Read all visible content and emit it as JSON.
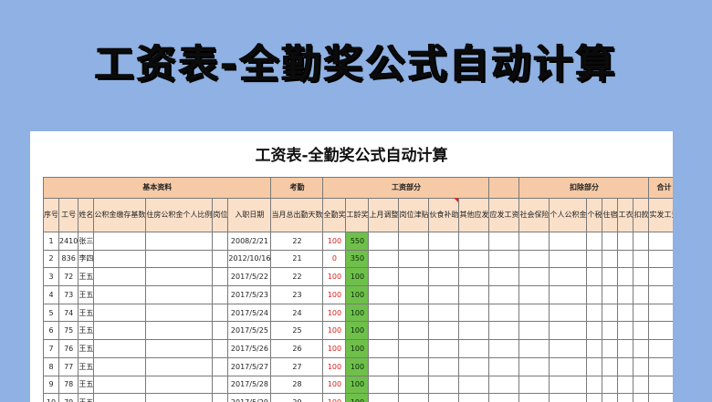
{
  "banner": {
    "title": "工资表-全勤奖公式自动计算"
  },
  "sheet": {
    "title": "工资表-全勤奖公式自动计算",
    "groups": {
      "basic": "基本资料",
      "attendance": "考勤",
      "salary": "工资部分",
      "deduction": "扣除部分",
      "total": "合计"
    },
    "columns": {
      "seq": "序号",
      "emp_no": "工号",
      "name": "姓名",
      "fund_base": "公积金缴存基数",
      "fund_ratio": "住房公积金个人比例",
      "position": "岗位",
      "hire_date": "入职日期",
      "days": "当月总出勤天数",
      "full_bonus": "全勤奖",
      "seniority": "工龄奖",
      "last_adjust": "上月调整",
      "post_allow": "岗位津贴",
      "meal_allow": "伙食补助",
      "other_pay": "其他应发",
      "gross_pay": "应发工资",
      "social": "社会保险",
      "fund_personal": "个人公积金",
      "tax": "个税",
      "housing": "住宿",
      "uniform": "工衣",
      "deduct": "扣款",
      "net_pay": "实发工资"
    },
    "rows": [
      {
        "seq": "1",
        "emp_no": "2410",
        "name": "张三",
        "hire_date": "2008/2/21",
        "days": "22",
        "full_bonus": "100",
        "seniority": "550"
      },
      {
        "seq": "2",
        "emp_no": "836",
        "name": "李四",
        "hire_date": "2012/10/16",
        "days": "21",
        "full_bonus": "0",
        "seniority": "350"
      },
      {
        "seq": "3",
        "emp_no": "72",
        "name": "王五",
        "hire_date": "2017/5/22",
        "days": "22",
        "full_bonus": "100",
        "seniority": "100"
      },
      {
        "seq": "4",
        "emp_no": "73",
        "name": "王五",
        "hire_date": "2017/5/23",
        "days": "23",
        "full_bonus": "100",
        "seniority": "100"
      },
      {
        "seq": "5",
        "emp_no": "74",
        "name": "王五",
        "hire_date": "2017/5/24",
        "days": "24",
        "full_bonus": "100",
        "seniority": "100"
      },
      {
        "seq": "6",
        "emp_no": "75",
        "name": "王五",
        "hire_date": "2017/5/25",
        "days": "25",
        "full_bonus": "100",
        "seniority": "100"
      },
      {
        "seq": "7",
        "emp_no": "76",
        "name": "王五",
        "hire_date": "2017/5/26",
        "days": "26",
        "full_bonus": "100",
        "seniority": "100"
      },
      {
        "seq": "8",
        "emp_no": "77",
        "name": "王五",
        "hire_date": "2017/5/27",
        "days": "27",
        "full_bonus": "100",
        "seniority": "100"
      },
      {
        "seq": "9",
        "emp_no": "78",
        "name": "王五",
        "hire_date": "2017/5/28",
        "days": "28",
        "full_bonus": "100",
        "seniority": "100"
      },
      {
        "seq": "10",
        "emp_no": "79",
        "name": "王五",
        "hire_date": "2017/5/29",
        "days": "29",
        "full_bonus": "100",
        "seniority": "100"
      }
    ]
  },
  "colors": {
    "background": "#8fb1e3",
    "header": "#f6caa6",
    "subheader": "#fbe0c9",
    "highlight_green": "#6ec04a",
    "red_text": "#e0201b"
  }
}
